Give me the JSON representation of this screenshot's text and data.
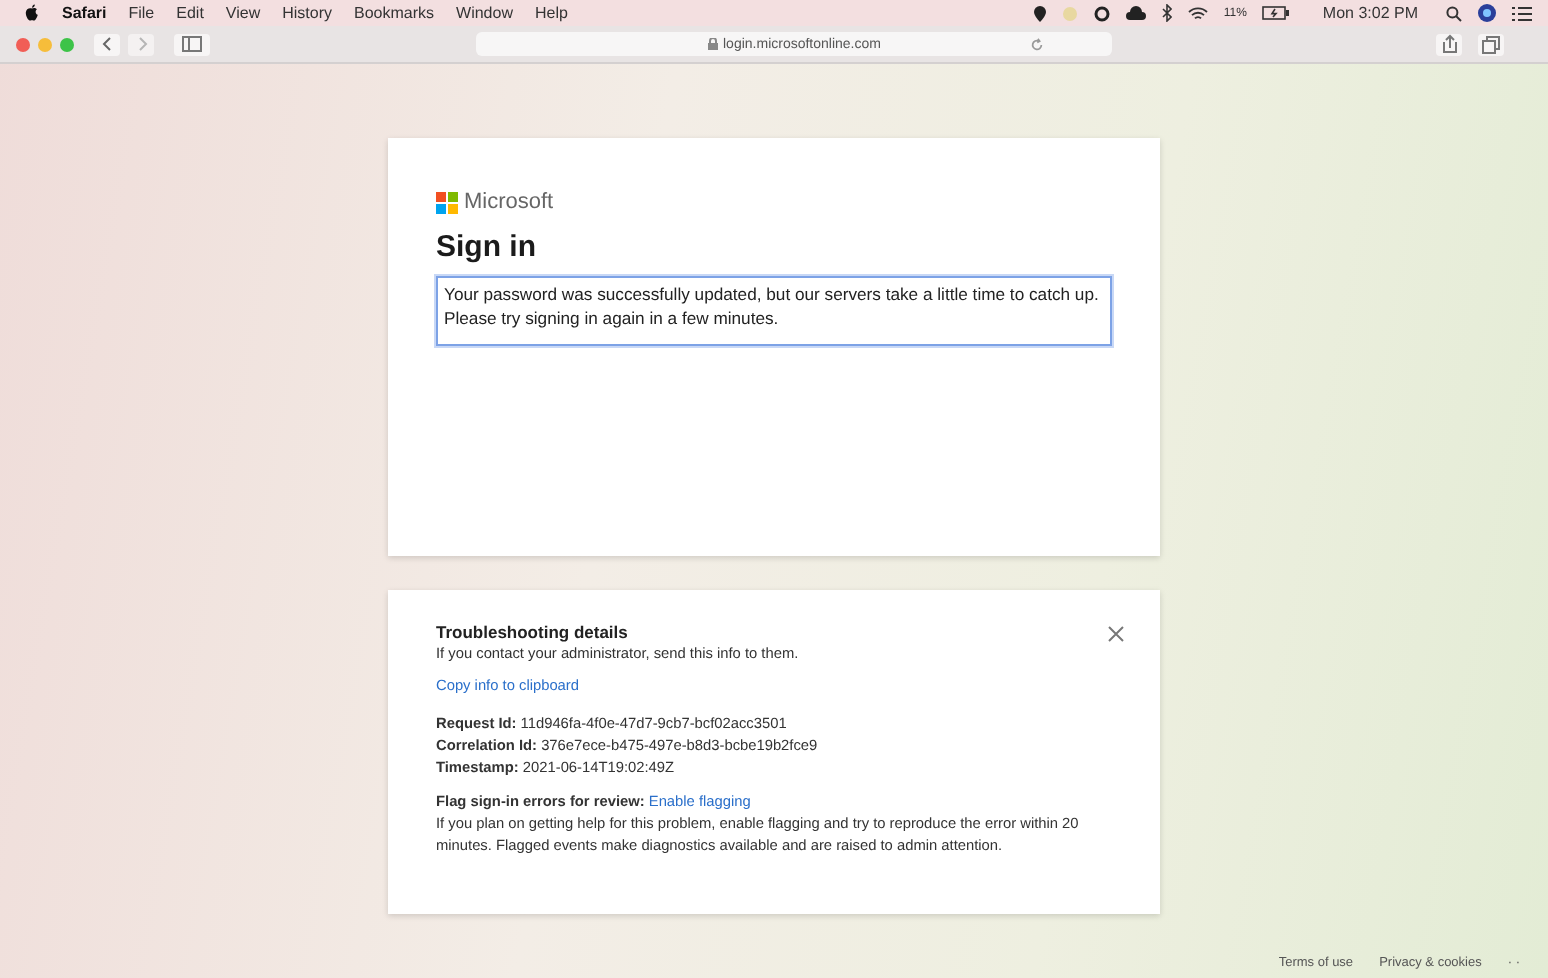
{
  "menu_bar": {
    "app": "Safari",
    "items": [
      "File",
      "Edit",
      "View",
      "History",
      "Bookmarks",
      "Window",
      "Help"
    ],
    "battery": "11%",
    "clock": "Mon 3:02 PM"
  },
  "toolbar": {
    "address": "login.microsoftonline.com"
  },
  "sign_in_card": {
    "brand": "Microsoft",
    "title": "Sign in",
    "message": "Your password was successfully updated, but our servers take a little time to catch up. Please try signing in again in a few minutes."
  },
  "troubleshooting": {
    "title": "Troubleshooting details",
    "intro": "If you contact your administrator, send this info to them.",
    "copy_link": "Copy info to clipboard",
    "details": [
      "**Request Id:** 11d946fa-4f0e-47d7-9cb7-bcf02acc3501",
      "**Correlation Id:** 376e7ece-b475-497e-b8d3-bcbe19b2fce9",
      "**Timestamp:** 2021-06-14T19:02:49Z"
    ],
    "flag_label": "Flag sign-in errors for review:",
    "flag_link": "Enable flagging",
    "flag_text": "If you plan on getting help for this problem, enable flagging and try to reproduce the error within 20 minutes. Flagged events make diagnostics available and are raised to admin attention."
  },
  "footer": {
    "links": [
      "Terms of use",
      "Privacy & cookies"
    ],
    "more": "· ·"
  }
}
